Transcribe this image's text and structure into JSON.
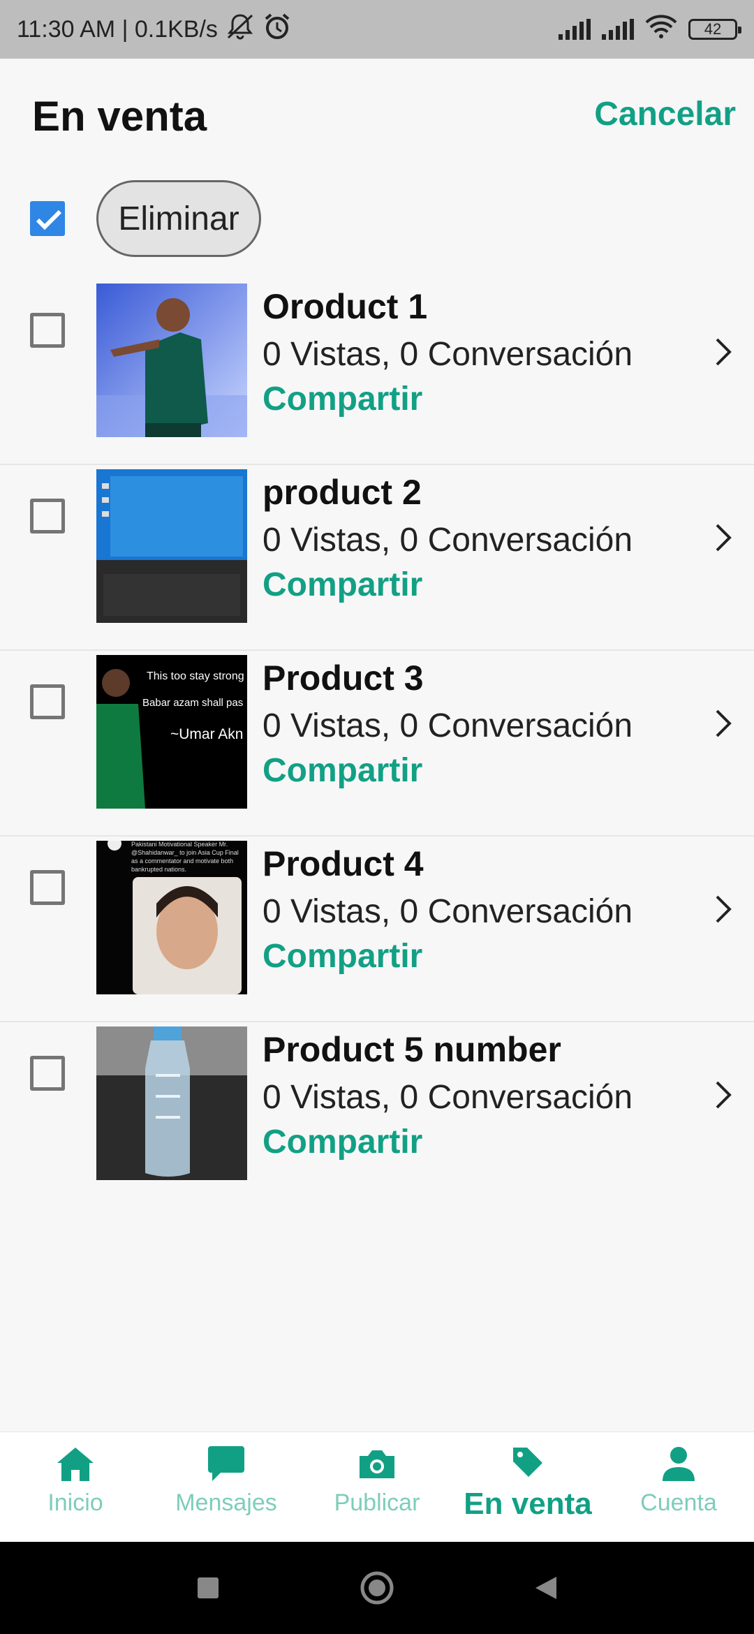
{
  "status_bar": {
    "time_speed": "11:30 AM | 0.1KB/s",
    "battery": "42",
    "icons": [
      "mute-icon",
      "alarm-icon",
      "signal-icon",
      "signal-icon",
      "wifi-icon",
      "battery-icon"
    ]
  },
  "header": {
    "title": "En venta",
    "cancel_label": "Cancelar"
  },
  "select_bar": {
    "select_all_checked": true,
    "delete_label": "Eliminar"
  },
  "products": [
    {
      "title": "Oroduct 1",
      "stats": "0 Vistas, 0 Conversación",
      "share": "Compartir",
      "checked": false
    },
    {
      "title": "product 2",
      "stats": "0 Vistas, 0 Conversación",
      "share": "Compartir",
      "checked": false
    },
    {
      "title": "Product 3",
      "stats": "0 Vistas, 0 Conversación",
      "share": "Compartir",
      "checked": false,
      "thumb_text": [
        "This too stay strong",
        "Babar azam shall pas",
        "~Umar Akn"
      ]
    },
    {
      "title": "Product 4",
      "stats": "0 Vistas, 0 Conversación",
      "share": "Compartir",
      "checked": false,
      "thumb_text": [
        "Pakistani Motivational Speaker Mr.",
        "@Shahidanwar_ to join Asia Cup Final",
        "as a commentator and motivate both",
        "bankrupted nations."
      ]
    },
    {
      "title": "Product 5 number",
      "stats": "0 Vistas, 0 Conversación",
      "share": "Compartir",
      "checked": false
    }
  ],
  "bottom_nav": [
    {
      "label": "Inicio",
      "icon": "home-icon",
      "active": false
    },
    {
      "label": "Mensajes",
      "icon": "message-icon",
      "active": false
    },
    {
      "label": "Publicar",
      "icon": "camera-icon",
      "active": false
    },
    {
      "label": "En venta",
      "icon": "tag-icon",
      "active": true
    },
    {
      "label": "Cuenta",
      "icon": "person-icon",
      "active": false
    }
  ],
  "colors": {
    "accent": "#12a085",
    "accent_light": "#7ecdb9",
    "checkbox_checked": "#2f86e5"
  }
}
